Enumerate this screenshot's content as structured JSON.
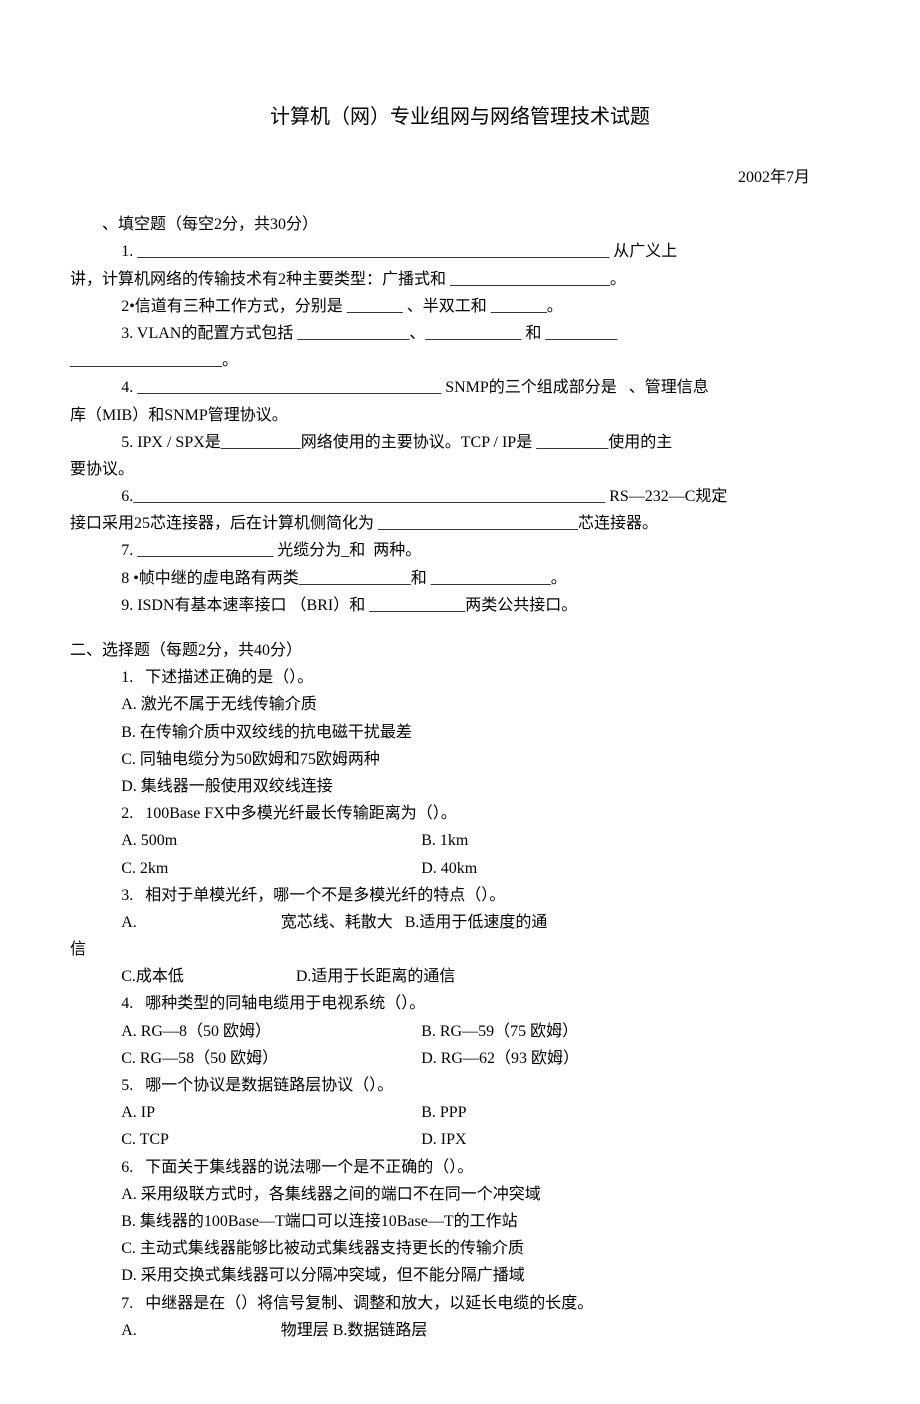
{
  "title": "计算机（网）专业组网与网络管理技术试题",
  "date": "2002年7月",
  "section1": {
    "head": "、填空题（每空2分，共30分）",
    "q1": "1. ___________________________________________________________ 从广义上",
    "q1b": "讲，计算机网络的传输技术有2种主要类型：广播式和 ____________________。",
    "q2": "2•信道有三种工作方式，分别是 _______ 、半双工和 _______。",
    "q3": "3. VLAN的配置方式包括 ______________、____________ 和 _________",
    "q3b": "___________________。",
    "q4": "4. ______________________________________ SNMP的三个组成部分是   、管理信息",
    "q4b": "库（MIB）和SNMP管理协议。",
    "q5": "5. IPX / SPX是__________网络使用的主要协议。TCP / IP是 _________使用的主",
    "q5b": "要协议。",
    "q6": "6.___________________________________________________________ RS—232—C规定",
    "q6b": "接口采用25芯连接器，后在计算机侧简化为 _________________________芯连接器。",
    "q7": "7. _________________ 光缆分为_和  两种。",
    "q8": "8 •帧中继的虚电路有两类______________和 _______________。",
    "q9": "9. ISDN有基本速率接口 （BRI）和 ____________两类公共接口。"
  },
  "section2": {
    "head": "二、选择题（每题2分，共40分）",
    "q1": {
      "stem": "1.   下述描述正确的是（）。",
      "a": "A. 激光不属于无线传输介质",
      "b": "B. 在传输介质中双绞线的抗电磁干扰最差",
      "c": "C. 同轴电缆分为50欧姆和75欧姆两种",
      "d": "D. 集线器一般使用双绞线连接"
    },
    "q2": {
      "stem": "2.   100Base FX中多模光纤最长传输距离为（）。",
      "a": "A. 500m",
      "b": "B. 1km",
      "c": "C. 2km",
      "d": "D. 40km"
    },
    "q3": {
      "stem": "3.   相对于单模光纤，哪一个不是多模光纤的特点（）。",
      "a": "A.                                    宽芯线、耗散大   B.适用于低速度的通",
      "a2": "信",
      "c": "C.成本低                            D.适用于长距离的通信"
    },
    "q4": {
      "stem": "4.   哪种类型的同轴电缆用于电视系统（）。",
      "a": "A. RG—8（50 欧姆）",
      "b": "B. RG—59（75 欧姆）",
      "c": "C. RG—58（50 欧姆）",
      "d": "D. RG—62（93 欧姆）"
    },
    "q5": {
      "stem": "5.   哪一个协议是数据链路层协议（）。",
      "a": "A. IP",
      "b": "B. PPP",
      "c": "C. TCP",
      "d": "D. IPX"
    },
    "q6": {
      "stem": "6.   下面关于集线器的说法哪一个是不正确的（）。",
      "a": "A. 采用级联方式时，各集线器之间的端口不在同一个冲突域",
      "b": "B. 集线器的100Base—T端口可以连接10Base—T的工作站",
      "c": "C. 主动式集线器能够比被动式集线器支持更长的传输介质",
      "d": "D. 采用交换式集线器可以分隔冲突域，但不能分隔广播域"
    },
    "q7": {
      "stem": "7.   中继器是在（）将信号复制、调整和放大，以延长电缆的长度。",
      "a": "A.                                    物理层 B.数据链路层"
    }
  }
}
